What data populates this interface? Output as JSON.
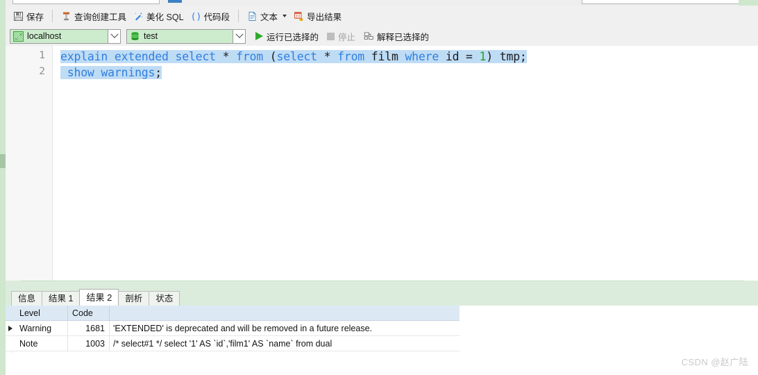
{
  "app": {
    "toolbar": {
      "items": [
        {
          "id": "save",
          "label": "保存",
          "icon": "save-icon"
        },
        {
          "id": "query-builder",
          "label": "查询创建工具",
          "icon": "query-builder-icon"
        },
        {
          "id": "beautify-sql",
          "label": "美化 SQL",
          "icon": "beautify-icon"
        },
        {
          "id": "code-snippet",
          "label": "代码段",
          "icon": "code-snippet-icon"
        },
        {
          "id": "text",
          "label": "文本",
          "icon": "text-icon"
        },
        {
          "id": "export-result",
          "label": "导出结果",
          "icon": "export-icon"
        }
      ]
    },
    "connection_bar": {
      "connection": {
        "value": "localhost",
        "icon": "mysql-dolphin-icon"
      },
      "database": {
        "value": "test",
        "icon": "database-icon"
      },
      "run_selected": "运行已选择的",
      "stop": "停止",
      "explain_selected": "解释已选择的"
    },
    "editor": {
      "line_numbers": [
        "1",
        "2"
      ],
      "lines": [
        {
          "number": "1",
          "tokens": [
            {
              "t": "explain",
              "k": "kw"
            },
            {
              "t": " ",
              "k": "pl"
            },
            {
              "t": "extended",
              "k": "kw"
            },
            {
              "t": " ",
              "k": "pl"
            },
            {
              "t": "select",
              "k": "kw"
            },
            {
              "t": " * ",
              "k": "pl"
            },
            {
              "t": "from",
              "k": "kw"
            },
            {
              "t": " (",
              "k": "pl"
            },
            {
              "t": "select",
              "k": "kw"
            },
            {
              "t": " * ",
              "k": "pl"
            },
            {
              "t": "from",
              "k": "kw"
            },
            {
              "t": " film ",
              "k": "pl"
            },
            {
              "t": "where",
              "k": "kw"
            },
            {
              "t": " id = ",
              "k": "pl"
            },
            {
              "t": "1",
              "k": "num"
            },
            {
              "t": ") tmp;",
              "k": "pl"
            }
          ]
        },
        {
          "number": "2",
          "tokens": [
            {
              "t": " ",
              "k": "pl"
            },
            {
              "t": "show",
              "k": "kw"
            },
            {
              "t": " ",
              "k": "pl"
            },
            {
              "t": "warnings",
              "k": "kw"
            },
            {
              "t": ";",
              "k": "pl"
            }
          ]
        }
      ]
    },
    "result_tabs": [
      {
        "id": "info",
        "label": "信息",
        "active": false
      },
      {
        "id": "result-1",
        "label": "结果 1",
        "active": false
      },
      {
        "id": "result-2",
        "label": "结果 2",
        "active": true
      },
      {
        "id": "profile",
        "label": "剖析",
        "active": false
      },
      {
        "id": "status",
        "label": "状态",
        "active": false
      }
    ],
    "grid": {
      "columns": [
        "Level",
        "Code",
        ""
      ],
      "rows": [
        {
          "selected": true,
          "level": "Warning",
          "code": "1681",
          "message": "'EXTENDED' is deprecated and will be removed in a future release."
        },
        {
          "selected": false,
          "level": "Note",
          "code": "1003",
          "message": "/* select#1 */ select '1' AS `id`,'film1' AS `name` from dual"
        }
      ]
    },
    "watermark": "CSDN @赵广陆",
    "colors": {
      "toolbar_bg": "#f0f0f0",
      "rail_green": "#cee7cd",
      "combo_green": "#cdeccd",
      "tab_strip_green": "#dcecdc",
      "selection_blue": "#bfdcf5",
      "keyword_blue": "#2f7fe0",
      "number_green": "#1aa81a",
      "grid_header_blue": "#dce9f5",
      "run_green": "#2eaa2e"
    }
  }
}
